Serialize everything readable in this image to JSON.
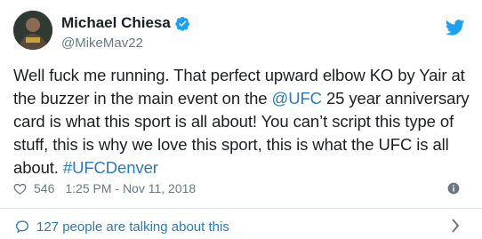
{
  "tweet": {
    "author": {
      "display_name": "Michael Chiesa",
      "handle": "@MikeMav22",
      "verified": true
    },
    "text_lines": [
      [
        "Well fuck me running. That perfect upward elbow KO by Yair at"
      ],
      [
        "the buzzer in the main event on the ",
        "@UFC",
        " 25 year anniversary"
      ],
      [
        "card is what this sport is all about! You can’t script this type of"
      ],
      [
        "stuff, this is why we love this sport, this is what the UFC is all"
      ],
      [
        "about. ",
        "#UFCDenver"
      ]
    ],
    "line_1": "Well fuck me running. That perfect upward elbow KO by Yair at",
    "line_2_pre": "the buzzer in the main event on the ",
    "mention": "@UFC",
    "line_2_post": " 25 year anniversary",
    "line_3": "card is what this sport is all about! You can’t script this type of",
    "line_4": "stuff, this is why we love this sport, this is what the UFC is all",
    "line_5_pre": "about. ",
    "hashtag": "#UFCDenver",
    "likes": "546",
    "timestamp": "1:25 PM - Nov 11, 2018",
    "talking": "127 people are talking about this"
  },
  "icons": {
    "verified": "verified-badge-icon",
    "bird": "twitter-bird-icon",
    "heart": "heart-icon",
    "info": "info-icon",
    "bubble": "speech-bubble-icon",
    "chevron": "chevron-right-icon"
  },
  "colors": {
    "accent": "#1da1f2",
    "link": "#2b7bb9",
    "text": "#1c2022",
    "muted": "#697882",
    "divider": "#e1e8ed"
  }
}
